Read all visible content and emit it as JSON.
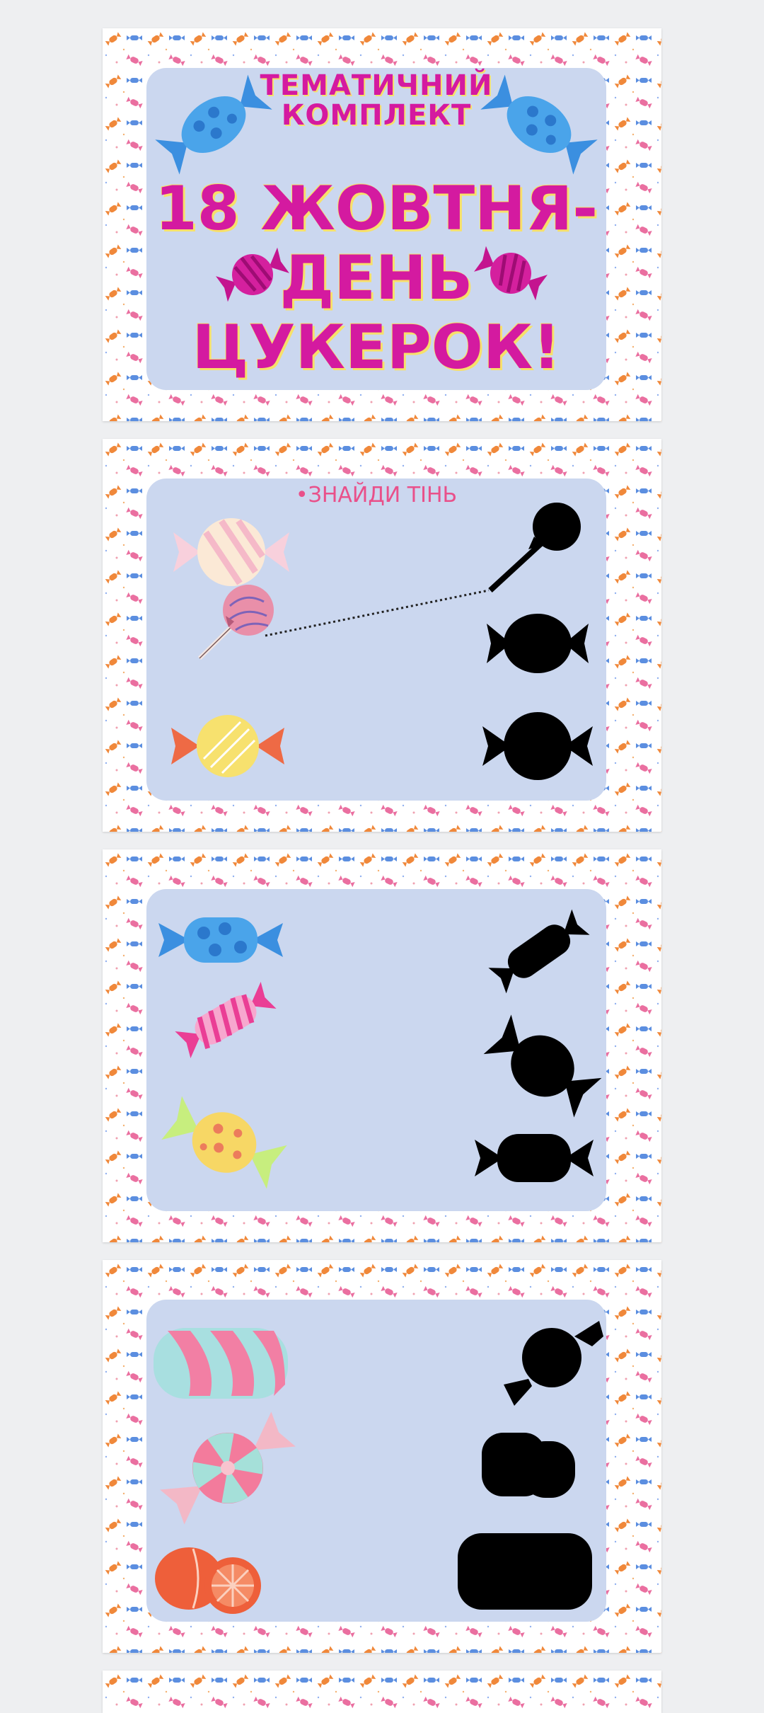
{
  "slides": [
    {
      "subtitle_line1": "ТЕМАТИЧНИЙ",
      "subtitle_line2": "КОМПЛЕКТ",
      "title_line1": "18 ЖОВТНЯ-",
      "title_line2": "ДЕНЬ",
      "title_line3": "ЦУКЕРОК!"
    },
    {
      "instruction": "•ЗНАЙДИ ТІНЬ"
    },
    {},
    {}
  ],
  "colors": {
    "panel": "#cbd7ef",
    "title": "#d41aa0",
    "title_outline": "#f7e06a",
    "instruction": "#e9508a",
    "shadow": "#000000"
  }
}
